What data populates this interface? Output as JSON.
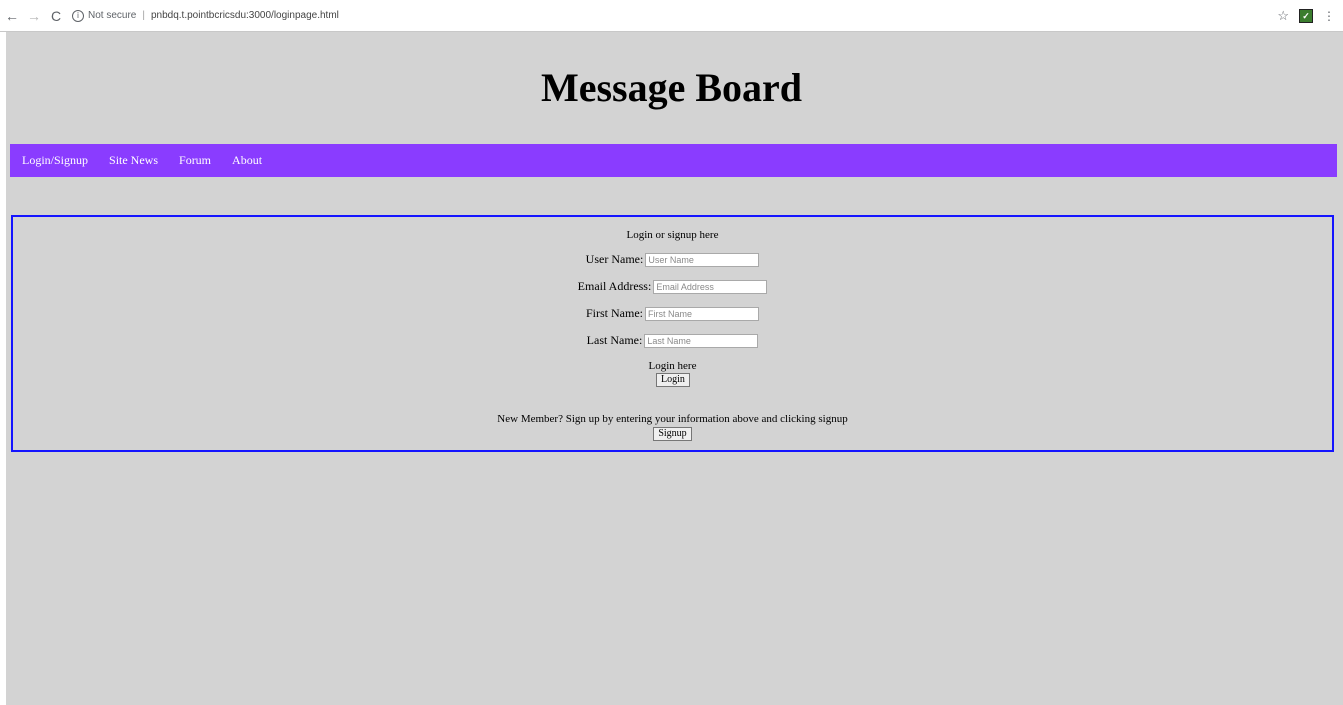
{
  "browser": {
    "info_glyph": "i",
    "security_label": "Not secure",
    "separator": "|",
    "url": "pnbdq.t.pointbcricsdu:3000/loginpage.html",
    "back_glyph": "←",
    "forward_glyph": "→",
    "reload_glyph": "C",
    "star_glyph": "☆",
    "extension_glyph": "✓",
    "menu_glyph": "⋮"
  },
  "page": {
    "title": "Message Board"
  },
  "nav": {
    "items": [
      "Login/Signup",
      "Site News",
      "Forum",
      "About"
    ],
    "color": "#8a3cff"
  },
  "form": {
    "heading": "Login or signup here",
    "user_name_label": "User Name:",
    "user_name_placeholder": "User Name",
    "email_label": "Email Address:",
    "email_placeholder": "Email Address",
    "first_name_label": "First Name:",
    "first_name_placeholder": "First Name",
    "last_name_label": "Last Name:",
    "last_name_placeholder": "Last Name",
    "login_text": "Login here",
    "login_button": "Login",
    "signup_text": "New Member? Sign up by entering your information above and clicking signup",
    "signup_button": "Signup",
    "border_color": "#1414ff"
  }
}
